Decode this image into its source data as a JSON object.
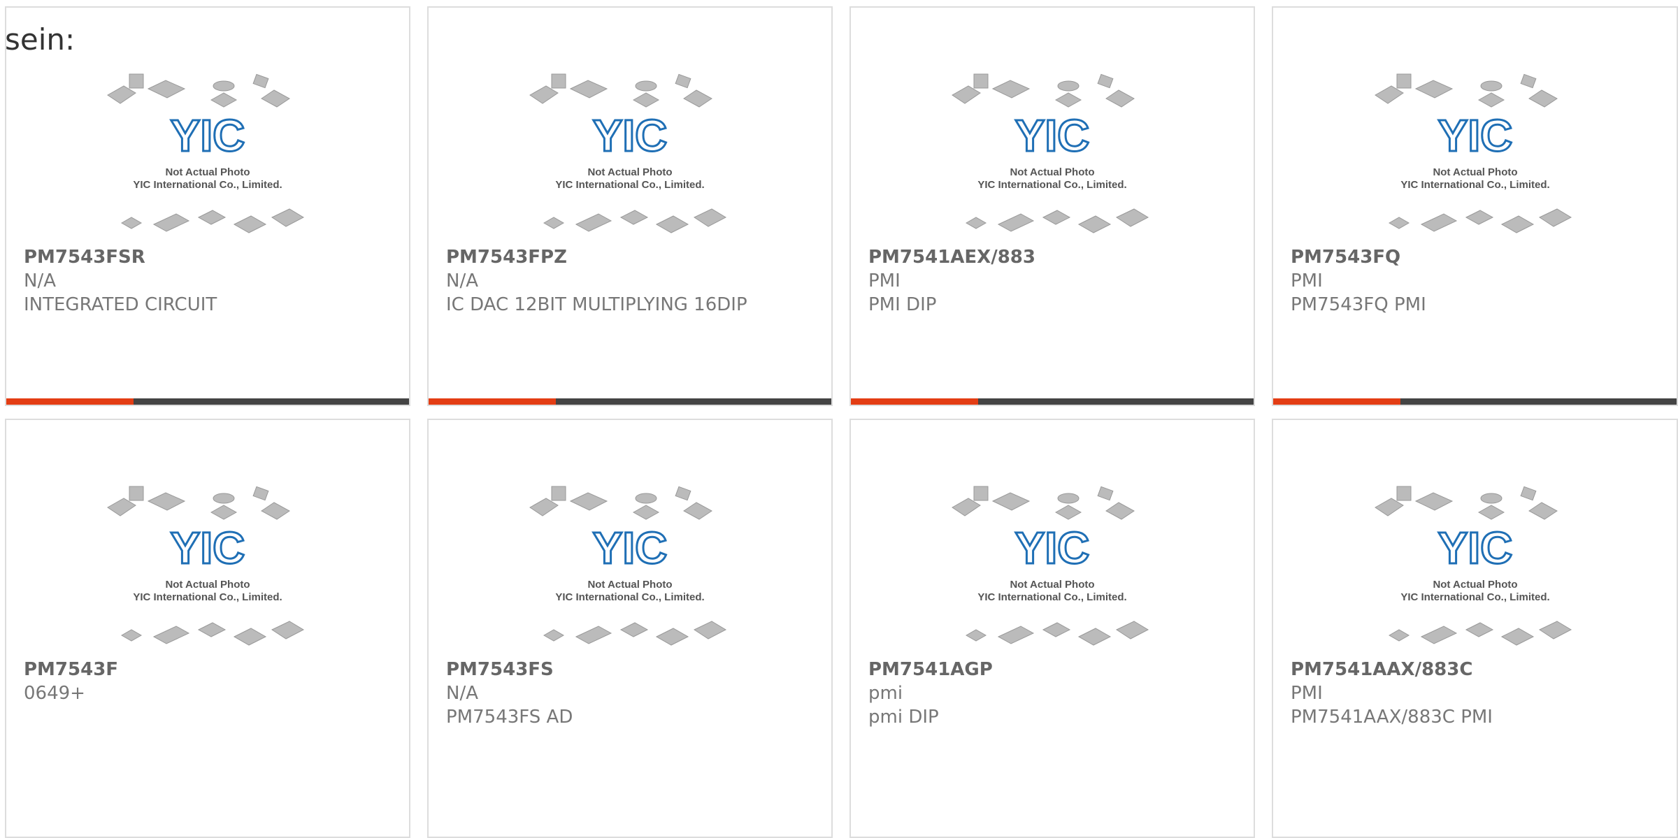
{
  "lead_text": "sein:",
  "accent_color": "#e33d14",
  "bar_color": "#444444",
  "placeholder": {
    "brand": "YIC",
    "line1": "Not Actual Photo",
    "line2": "YIC International Co., Limited."
  },
  "products": [
    {
      "part": "PM7543FSR",
      "maker": "N/A",
      "desc": "INTEGRATED CIRCUIT"
    },
    {
      "part": "PM7543FPZ",
      "maker": "N/A",
      "desc": "IC DAC 12BIT MULTIPLYING 16DIP"
    },
    {
      "part": "PM7541AEX/883",
      "maker": "PMI",
      "desc": "PMI DIP"
    },
    {
      "part": "PM7543FQ",
      "maker": "PMI",
      "desc": "PM7543FQ PMI"
    },
    {
      "part": "PM7543F",
      "maker": "0649+",
      "desc": ""
    },
    {
      "part": "PM7543FS",
      "maker": "N/A",
      "desc": "PM7543FS AD"
    },
    {
      "part": "PM7541AGP",
      "maker": "pmi",
      "desc": "pmi DIP"
    },
    {
      "part": "PM7541AAX/883C",
      "maker": "PMI",
      "desc": "PM7541AAX/883C PMI"
    }
  ]
}
